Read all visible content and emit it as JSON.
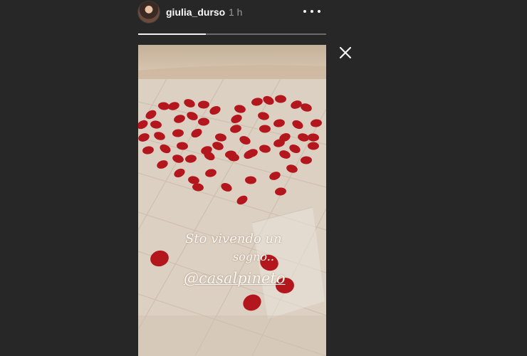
{
  "header": {
    "username": "giulia_durso",
    "time": "1 h",
    "more_icon": "more-horizontal-icon"
  },
  "progress": {
    "fraction": 0.36
  },
  "story": {
    "caption_line1": "Sto vivendo un",
    "caption_line2": "sogno..",
    "mention": "@casalpineto"
  },
  "controls": {
    "close_icon": "close-icon"
  },
  "colors": {
    "background": "#272727",
    "petal": "#b3171d",
    "progress_track": "#6a6a6a",
    "progress_fill": "#efefef"
  }
}
